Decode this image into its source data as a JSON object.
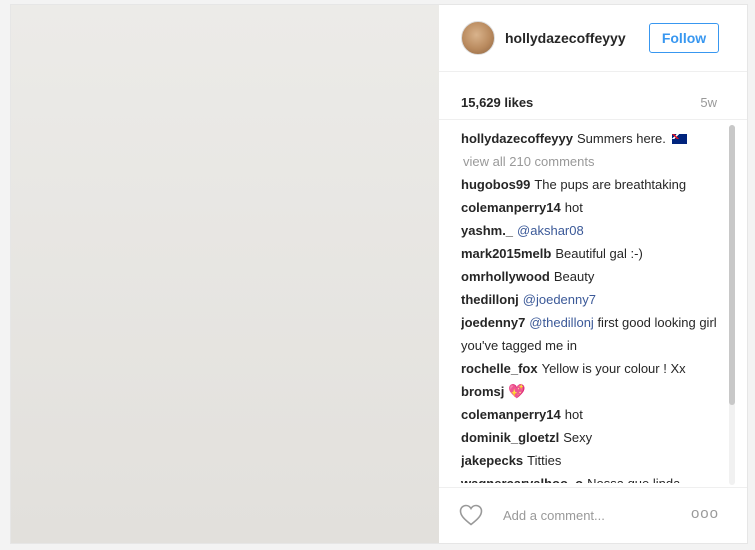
{
  "post": {
    "username": "hollydazecoffeyyy",
    "follow_label": "Follow",
    "likes": "15,629 likes",
    "age": "5w",
    "caption": {
      "user": "hollydazecoffeyyy",
      "text": "Summers here."
    },
    "view_all": "view all 210 comments",
    "add_comment_placeholder": "Add a comment...",
    "more_label": "ooo"
  },
  "comments": [
    {
      "user": "hugobos99",
      "text": "The pups are breathtaking"
    },
    {
      "user": "colemanperry14",
      "text": "hot"
    },
    {
      "user": "yashm._",
      "mention": "@akshar08",
      "text": ""
    },
    {
      "user": "mark2015melb",
      "text": "Beautiful gal :-)"
    },
    {
      "user": "omrhollywood",
      "text": "Beauty"
    },
    {
      "user": "thedillonj",
      "mention": "@joedenny7",
      "text": ""
    },
    {
      "user": "joedenny7",
      "mention": "@thedillonj",
      "text": "first good looking girl you've tagged me in"
    },
    {
      "user": "rochelle_fox",
      "text": "Yellow is your colour ! Xx"
    },
    {
      "user": "bromsj",
      "text": "💖"
    },
    {
      "user": "colemanperry14",
      "text": "hot"
    },
    {
      "user": "dominik_gloetzl",
      "text": "Sexy"
    },
    {
      "user": "jakepecks",
      "text": "Titties"
    },
    {
      "user": "wagnercarvalhoo_o",
      "text": "Nossa que linda"
    }
  ],
  "colors": {
    "accent": "#3897f0",
    "text": "#262626",
    "muted": "#999999",
    "mention": "#3b5998"
  }
}
